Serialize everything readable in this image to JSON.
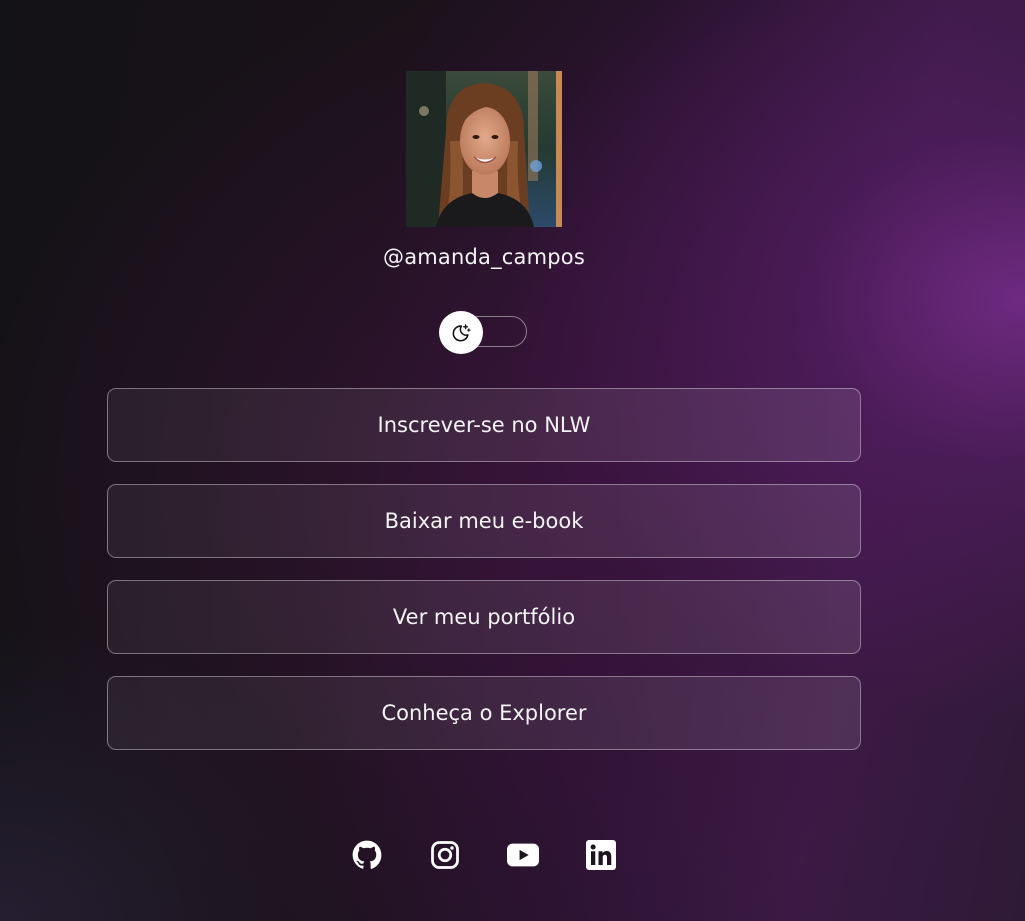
{
  "profile": {
    "username": "@amanda_campos",
    "avatar_alt": "Amanda Campos"
  },
  "theme_switch": {
    "icon": "moon-stars-icon",
    "state": "dark"
  },
  "links": [
    {
      "label": "Inscrever-se no NLW"
    },
    {
      "label": "Baixar meu e-book"
    },
    {
      "label": "Ver meu portfólio"
    },
    {
      "label": "Conheça o Explorer"
    }
  ],
  "social": [
    {
      "name": "github",
      "icon": "github-icon"
    },
    {
      "name": "instagram",
      "icon": "instagram-icon"
    },
    {
      "name": "youtube",
      "icon": "youtube-icon"
    },
    {
      "name": "linkedin",
      "icon": "linkedin-icon"
    }
  ],
  "colors": {
    "accent": "#5f2470",
    "background_dark": "#131216",
    "text": "#f3f3f3"
  }
}
